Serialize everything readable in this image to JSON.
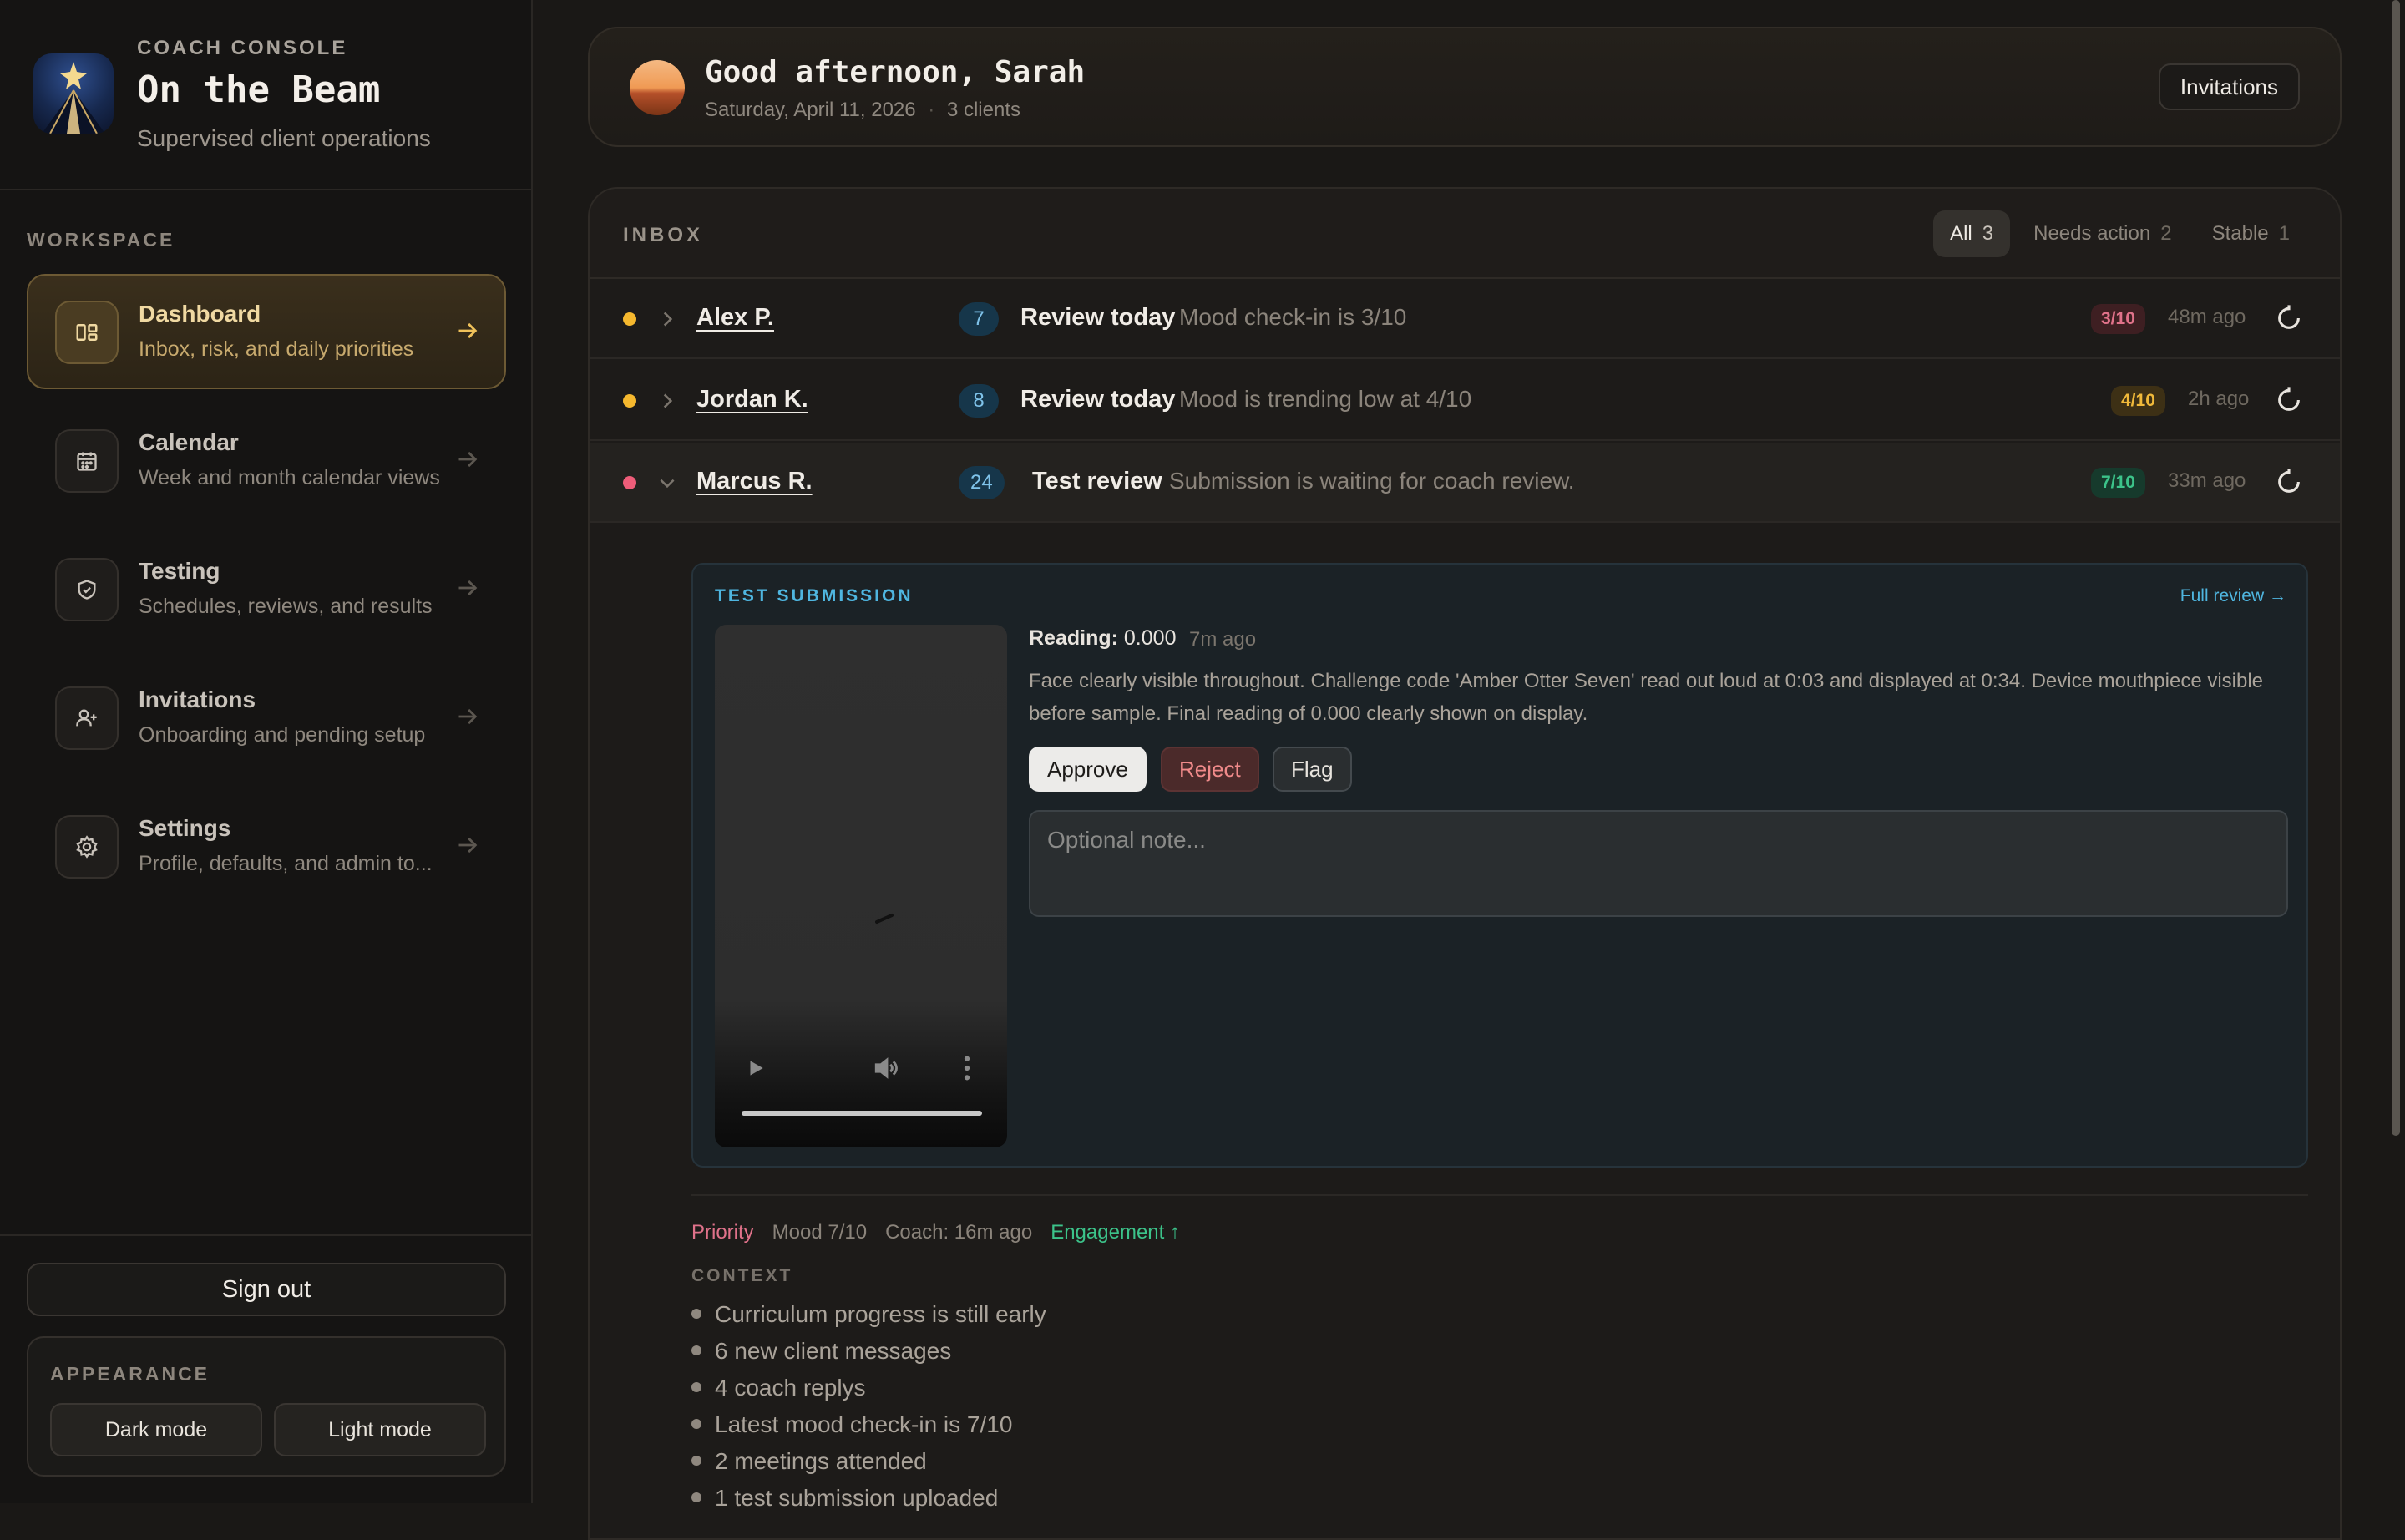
{
  "brand": {
    "eyebrow": "COACH CONSOLE",
    "title": "On the Beam",
    "subtitle": "Supervised client operations"
  },
  "sidebar": {
    "section_label": "WORKSPACE",
    "items": [
      {
        "title": "Dashboard",
        "desc": "Inbox, risk, and daily priorities",
        "icon": "dashboard-icon",
        "active": true
      },
      {
        "title": "Calendar",
        "desc": "Week and month calendar views",
        "icon": "calendar-icon",
        "active": false
      },
      {
        "title": "Testing",
        "desc": "Schedules, reviews, and results",
        "icon": "shield-icon",
        "active": false
      },
      {
        "title": "Invitations",
        "desc": "Onboarding and pending setup",
        "icon": "add-user-icon",
        "active": false
      },
      {
        "title": "Settings",
        "desc": "Profile, defaults, and admin to...",
        "icon": "gear-icon",
        "active": false
      }
    ],
    "sign_out": "Sign out",
    "appearance": {
      "label": "APPEARANCE",
      "dark": "Dark mode",
      "light": "Light mode"
    }
  },
  "header": {
    "greeting": "Good afternoon, Sarah",
    "date": "Saturday, April 11, 2026",
    "separator": "·",
    "clients": "3 clients",
    "invitations_button": "Invitations"
  },
  "inbox": {
    "title": "INBOX",
    "filters": [
      {
        "label": "All",
        "count": "3",
        "active": true
      },
      {
        "label": "Needs action",
        "count": "2",
        "active": false
      },
      {
        "label": "Stable",
        "count": "1",
        "active": false
      }
    ],
    "rows": [
      {
        "name": "Alex P.",
        "count": "7",
        "title": "Review today",
        "desc": "Mood check-in is 3/10",
        "score": "3/10",
        "ago": "48m ago",
        "dot_color": "#f5b82e",
        "score_bg": "#3e1f22",
        "score_fg": "#e0728a",
        "expanded": false
      },
      {
        "name": "Jordan K.",
        "count": "8",
        "title": "Review today",
        "desc": "Mood is trending low at 4/10",
        "score": "4/10",
        "ago": "2h ago",
        "dot_color": "#f5b82e",
        "score_bg": "#3d3015",
        "score_fg": "#f0b93a",
        "expanded": false
      },
      {
        "name": "Marcus R.",
        "count": "24",
        "title": "Test review",
        "desc": "Submission is waiting for coach review.",
        "score": "7/10",
        "ago": "33m ago",
        "dot_color": "#ee5d79",
        "score_bg": "#163a2c",
        "score_fg": "#3cc38a",
        "expanded": true
      }
    ]
  },
  "submission": {
    "label": "TEST SUBMISSION",
    "full_review": "Full review →",
    "reading_label": "Reading:",
    "reading_value": "0.000",
    "reading_ago": "7m ago",
    "description": "Face clearly visible throughout. Challenge code 'Amber Otter Seven' read out loud at 0:03 and displayed at 0:34. Device mouthpiece visible before sample. Final reading of 0.000 clearly shown on display.",
    "approve": "Approve",
    "reject": "Reject",
    "flag": "Flag",
    "note_placeholder": "Optional note..."
  },
  "context": {
    "priority": "Priority",
    "mood": "Mood 7/10",
    "coach": "Coach: 16m ago",
    "engagement": "Engagement ↑",
    "label": "CONTEXT",
    "items": [
      "Curriculum progress is still early",
      "6 new client messages",
      "4 coach replys",
      "Latest mood check-in is 7/10",
      "2 meetings attended",
      "1 test submission uploaded"
    ]
  }
}
